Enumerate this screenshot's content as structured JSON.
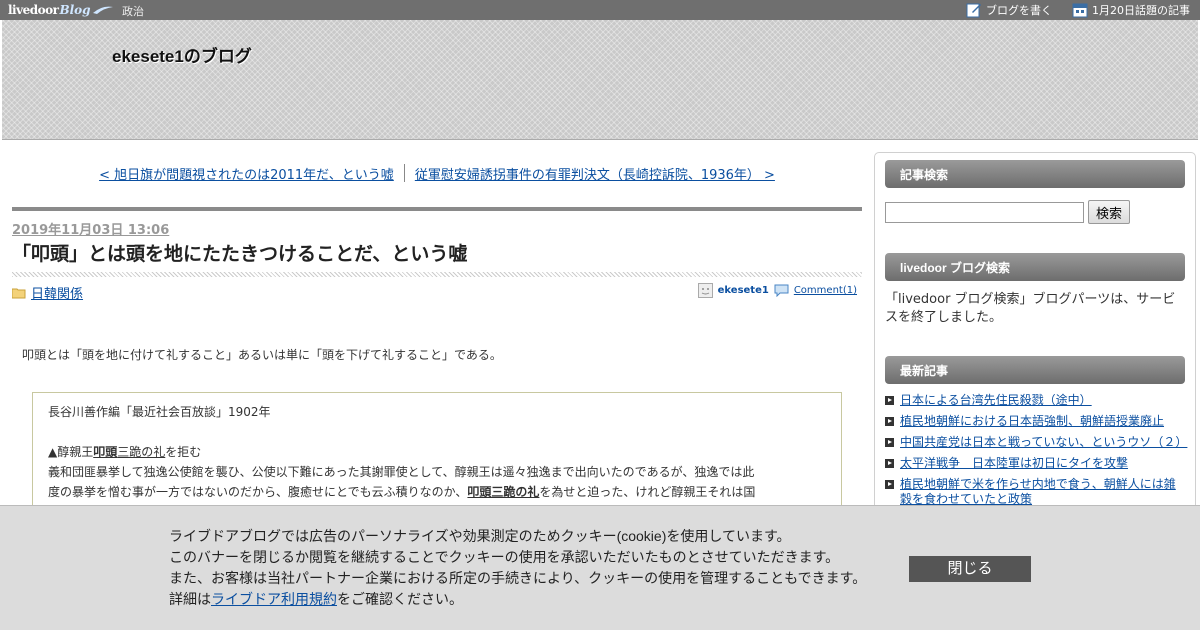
{
  "topbar": {
    "logo_main": "livedoor",
    "logo_sub": "Blog",
    "category": "政治",
    "write_blog": "ブログを書く",
    "topic_articles": "1月20日話題の記事"
  },
  "header": {
    "blog_title": "ekesete1のブログ"
  },
  "pager": {
    "prev": "< 旭日旗が問題視されたのは2011年だ、という嘘",
    "next": "従軍慰安婦誘拐事件の有罪判決文（長崎控訴院、1936年） >"
  },
  "article": {
    "date": "2019年11月03日 13:06",
    "title": "「叩頭」とは頭を地にたたきつけることだ、という嘘",
    "category": "日韓関係",
    "author": "ekesete1",
    "comments": "Comment(1)",
    "intro": "叩頭とは「頭を地に付けて礼すること」あるいは単に「頭を下げて礼すること」である。",
    "quote": {
      "source": "長谷川善作編「最近社会百放談」1902年",
      "line1_pre": "▲醇親王",
      "line1_kw": "叩頭",
      "line1_kw2": "三跪の礼",
      "line1_post": "を拒む",
      "line2": "義和団匪暴挙して独逸公使館を襲ひ、公使以下難にあった其謝罪使として、醇親王は遥々独逸まで出向いたのであるが、独逸では此",
      "line3_pre": "度の暴挙を憎む事が一方ではないのだから、腹癒せにとでも云ふ積りなのか、",
      "line3_kw": "叩頭三跪の礼",
      "line3_post": "を為せと迫った、けれど醇親王それは国"
    }
  },
  "sidebar": {
    "search": {
      "heading": "記事検索",
      "placeholder": "",
      "button": "検索"
    },
    "ld_search": {
      "heading": "livedoor ブログ検索",
      "text": "「livedoor ブログ検索」ブログパーツは、サービスを終了しました。"
    },
    "recent": {
      "heading": "最新記事",
      "items": [
        "日本による台湾先住民殺戮（途中）",
        "植民地朝鮮における日本語強制、朝鮮語授業廃止",
        "中国共産党は日本と戦っていない、というウソ（２）",
        "太平洋戦争　日本陸軍は初日にタイを攻撃",
        "植民地朝鮮で米を作らせ内地で食う、朝鮮人には雑穀を食わせていたと政策"
      ]
    }
  },
  "cookie": {
    "line1": "ライブドアブログでは広告のパーソナライズや効果測定のためクッキー(cookie)を使用しています。",
    "line2": "このバナーを閉じるか閲覧を継続することでクッキーの使用を承認いただいたものとさせていただきます。",
    "line3": "また、お客様は当社パートナー企業における所定の手続きにより、クッキーの使用を管理することもできます。",
    "line4_pre": "詳細は",
    "line4_link": "ライブドア利用規約",
    "line4_post": "をご確認ください。",
    "close": "閉じる"
  }
}
